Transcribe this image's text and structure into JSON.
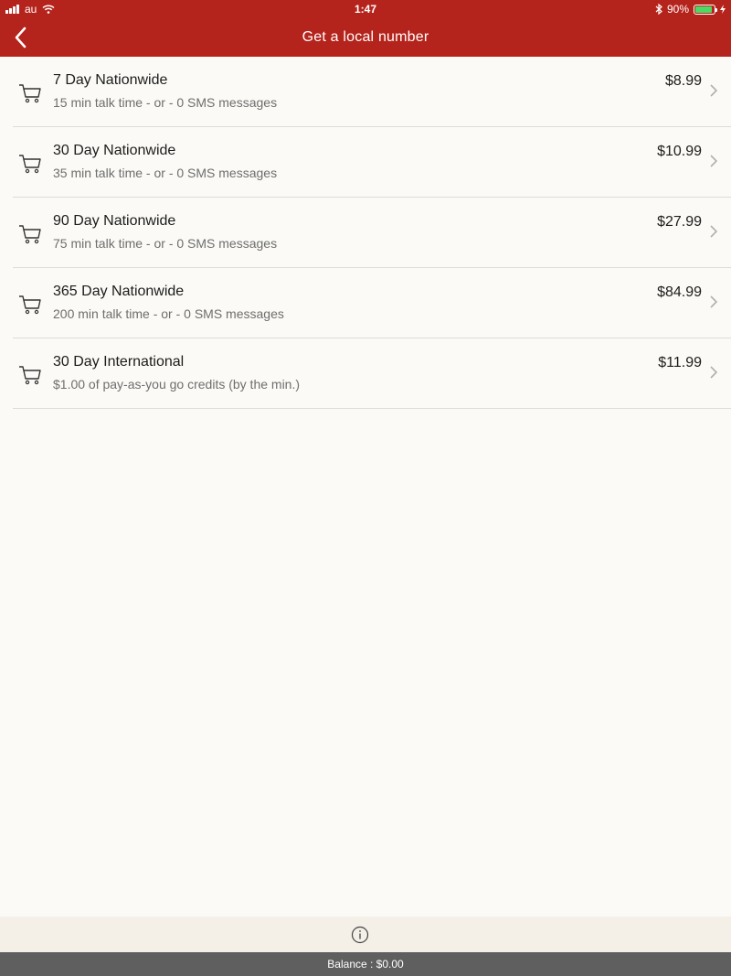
{
  "status_bar": {
    "carrier": "au",
    "time": "1:47",
    "battery_percent_label": "90%",
    "battery_level": 0.9,
    "icons": [
      "signal-icon",
      "wifi-icon",
      "bluetooth-icon",
      "battery-icon",
      "charging-icon"
    ]
  },
  "nav": {
    "title": "Get a local number",
    "back_icon": "chevron-left-icon"
  },
  "plans": [
    {
      "title": "7 Day Nationwide",
      "subtitle": "15 min talk time - or - 0 SMS messages",
      "price": "$8.99"
    },
    {
      "title": "30 Day Nationwide",
      "subtitle": "35 min talk time - or - 0 SMS messages",
      "price": "$10.99"
    },
    {
      "title": "90 Day Nationwide",
      "subtitle": "75 min talk time - or - 0 SMS messages",
      "price": "$27.99"
    },
    {
      "title": "365 Day Nationwide",
      "subtitle": "200 min talk time - or - 0 SMS messages",
      "price": "$84.99"
    },
    {
      "title": "30 Day International",
      "subtitle": "$1.00 of pay-as-you go credits (by the min.)",
      "price": "$11.99"
    }
  ],
  "footer": {
    "info_icon": "info-icon",
    "balance": "Balance : $0.00"
  },
  "colors": {
    "header": "#b5241c",
    "background": "#fbfaf6",
    "footer": "#f4f0e7",
    "balance_bar": "#5f5f5f",
    "battery": "#4cd964"
  }
}
